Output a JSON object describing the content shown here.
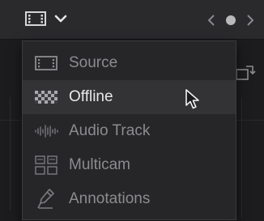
{
  "viewer_button": {
    "icon": "film-strip-icon",
    "dropdown_icon": "chevron-down-icon"
  },
  "nav": {
    "prev_icon": "chevron-left-icon",
    "dot_icon": "circle-icon",
    "next_icon": "chevron-right-icon"
  },
  "menu": {
    "selected_index": 1,
    "items": [
      {
        "label": "Source",
        "icon": "film-strip-icon"
      },
      {
        "label": "Offline",
        "icon": "checkerboard-icon"
      },
      {
        "label": "Audio Track",
        "icon": "waveform-icon"
      },
      {
        "label": "Multicam",
        "icon": "multicam-grid-icon"
      },
      {
        "label": "Annotations",
        "icon": "pen-icon"
      }
    ]
  },
  "colors": {
    "menu_bg": "#262628",
    "selected_bg": "#333336",
    "label": "#8c8c90",
    "label_selected": "#e8e8ea"
  }
}
